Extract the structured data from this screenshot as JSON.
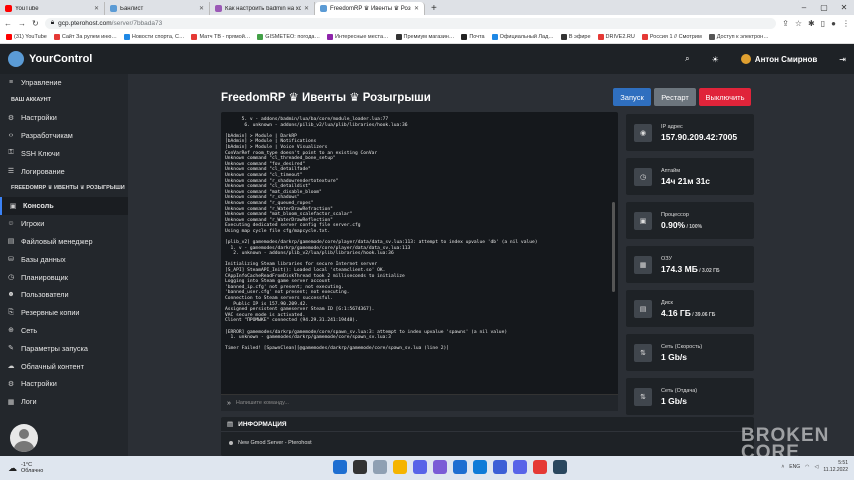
{
  "browser": {
    "tabs": [
      {
        "title": "YouTube",
        "color": "#ff0000"
      },
      {
        "title": "Банлист",
        "color": "#5b9bd5"
      },
      {
        "title": "Как настроить badmin на хостинге",
        "color": "#9b59b6"
      },
      {
        "title": "FreedomRP ♛ Ивенты ♛ Розыгр",
        "color": "#5b9bd5"
      }
    ],
    "url_host": "gcp.pterohost.com",
    "url_path": "/server/7bbada73",
    "bookmarks": [
      {
        "label": "(31) YouTube",
        "color": "#ff0000"
      },
      {
        "label": "Сайт За рулем иню…",
        "color": "#e53935"
      },
      {
        "label": "Новости спорта, С…",
        "color": "#1e88e5"
      },
      {
        "label": "Матч ТВ - прямой…",
        "color": "#e53935"
      },
      {
        "label": "GISMETEO: погода…",
        "color": "#43a047"
      },
      {
        "label": "Интересные места…",
        "color": "#8e24aa"
      },
      {
        "label": "Премиум магазин…",
        "color": "#333333"
      },
      {
        "label": "Почта",
        "color": "#222222"
      },
      {
        "label": "Официальный Лад…",
        "color": "#1e88e5"
      },
      {
        "label": "В эфире",
        "color": "#333333"
      },
      {
        "label": "DRIVE2.RU",
        "color": "#e53935"
      },
      {
        "label": "Россия 1 // Смотрим",
        "color": "#e53935"
      },
      {
        "label": "Доступ к электрон…",
        "color": "#555555"
      }
    ]
  },
  "app": {
    "name": "YourControl",
    "user_name": "Антон Смирнов"
  },
  "sidebar": {
    "items": [
      {
        "label": "Управление",
        "icon": "≡",
        "section": 0
      },
      {
        "label": "Настройки",
        "icon": "⚙",
        "section": 1
      },
      {
        "label": "Разработчикам",
        "icon": "‹›",
        "section": 1
      },
      {
        "label": "SSH Ключи",
        "icon": "⚿",
        "section": 1
      },
      {
        "label": "Логирование",
        "icon": "☰",
        "section": 1
      },
      {
        "label": "Консоль",
        "icon": "▣",
        "section": 2,
        "active": true
      },
      {
        "label": "Игроки",
        "icon": "☺",
        "section": 2
      },
      {
        "label": "Файловый менеджер",
        "icon": "▤",
        "section": 2
      },
      {
        "label": "Базы данных",
        "icon": "⛁",
        "section": 2
      },
      {
        "label": "Планировщик",
        "icon": "◷",
        "section": 2
      },
      {
        "label": "Пользователи",
        "icon": "☻",
        "section": 2
      },
      {
        "label": "Резервные копии",
        "icon": "⎘",
        "section": 2
      },
      {
        "label": "Сеть",
        "icon": "⊕",
        "section": 2
      },
      {
        "label": "Параметры запуска",
        "icon": "✎",
        "section": 2
      },
      {
        "label": "Облачный контент",
        "icon": "☁",
        "section": 2
      },
      {
        "label": "Настройки",
        "icon": "⚙",
        "section": 2
      },
      {
        "label": "Логи",
        "icon": "▦",
        "section": 2
      }
    ],
    "heading_account": "ВАШ АККАУНТ",
    "heading_server": "FREEDOMRP ♛ ИВЕНТЫ ♛ РОЗЫГРЫШИ"
  },
  "page": {
    "title": "FreedomRP ♛ Ивенты ♛ Розыгрыши",
    "start_label": "Запуск",
    "restart_label": "Рестарт",
    "stop_label": "Выключить",
    "command_placeholder": "Напишите команду...",
    "console_lines": [
      "      5. v - addons/badmin/lua/ba/core/module_loader.lua:77",
      "       6. unknown - addons/pilib_v2/lua/plib/libraries/hook.lua:36",
      "",
      "[bAdmin] > Module | DarkRP",
      "[bAdmin] > Module | Notifications",
      "[bAdmin] > Module | Voice Visualizers",
      "ConVarRef room_type doesn't point to an existing ConVar",
      "Unknown command \"cl_threaded_bone_setup\"",
      "Unknown command \"fov_desired\"",
      "Unknown command \"cl_detailfade\"",
      "Unknown command \"cl_timeout\"",
      "Unknown command \"r_shadowrendertotexture\"",
      "Unknown command \"cl_detaildist\"",
      "Unknown command \"mat_disable_bloom\"",
      "Unknown command \"r_shadows\"",
      "Unknown command \"r_queued_ropes\"",
      "Unknown command \"r_WaterDrawRefraction\"",
      "Unknown command \"mat_bloom_scalefactor_scalar\"",
      "Unknown command \"r_WaterDrawReflection\"",
      "Executing dedicated server config file server.cfg",
      "Using map cycle file cfg/mapcycle.txt.",
      "",
      "[plib_v2] gamemodes/darkrp/gamemode/core/player/data/data_sv.lua:113: attempt to index upvalue 'db' (a nil value)",
      "  1. v - gamemodes/darkrp/gamemode/core/player/data/data_sv.lua:113",
      "   2. unknown - addons/plib_v2/lua/plib/libraries/hook.lua:36",
      "",
      "Initializing Steam libraries for secure Internet server",
      "[S_API] SteamAPI_Init(): Loaded local 'steamclient.so' OK.",
      "CAppInfoCacheReadFromDiskThread took 2 milliseconds to initialize",
      "Logging into Steam game server account",
      "'banned_ip.cfg' not present; not executing.",
      "'banned_user.cfg' not present; not executing.",
      "Connection to Steam servers successful.",
      "   Public IP is 157.90.209.42.",
      "Assigned persistent gameserver Steam ID [G:1:5674367].",
      "VAC secure mode is activated.",
      "Client \"ПРОМЫКЕ\" connected (94.29.31.241:19448).",
      "",
      "[ERROR] gamemodes/darkrp/gamemode/core/spawn_sv.lua:3: attempt to index upvalue 'spawns' (a nil value)",
      "  1. unknown - gamemodes/darkrp/gamemode/core/spawn_sv.lua:3",
      "",
      "Timer Failed! [SpawnClean][@gamemodes/darkrp/gamemode/core/spawn_sv.lua (line 2)]"
    ]
  },
  "stats": [
    {
      "label": "IP адрес",
      "value": "157.90.209.42:7005",
      "sub": "",
      "icon": "wifi-icon",
      "glyph": "◉"
    },
    {
      "label": "Аптайм",
      "value": "14ч 21м 31с",
      "sub": "",
      "icon": "clock-icon",
      "glyph": "◷"
    },
    {
      "label": "Процессор",
      "value": "0.90%",
      "sub": " / 100%",
      "icon": "cpu-icon",
      "glyph": "▣"
    },
    {
      "label": "ОЗУ",
      "value": "174.3 МБ",
      "sub": " / 3.02 ГБ",
      "icon": "memory-icon",
      "glyph": "▦"
    },
    {
      "label": "Диск",
      "value": "4.16 ГБ",
      "sub": " / 39.06 ГБ",
      "icon": "disk-icon",
      "glyph": "▤"
    },
    {
      "label": "Сеть (Скорость)",
      "value": "1 Gb/s",
      "sub": "",
      "icon": "network-up-icon",
      "glyph": "⇅"
    },
    {
      "label": "Сеть (Отдача)",
      "value": "1 Gb/s",
      "sub": "",
      "icon": "network-down-icon",
      "glyph": "⇅"
    }
  ],
  "info": {
    "heading": "ИНФОРМАЦИЯ",
    "item": "New Gmod Server - Pterohost"
  },
  "watermark": [
    "BROKEN",
    "CORE"
  ],
  "taskbar": {
    "temp": "-1°C",
    "weather": "Облачно",
    "lang": "ENG",
    "time": "5:51",
    "date": "11.12.2022",
    "apps": [
      "#1f6fd1",
      "#333333",
      "#8fa0b3",
      "#f5b400",
      "#5864e8",
      "#7b5cd6",
      "#1f6fd1",
      "#0f7bd8",
      "#3c5fd6",
      "#5864e8",
      "#e53935",
      "#2a475e"
    ]
  },
  "colors": {
    "accent": "#3b82f6",
    "start": "#2f6fbf",
    "restart": "#6c757d",
    "stop": "#e0243a"
  }
}
